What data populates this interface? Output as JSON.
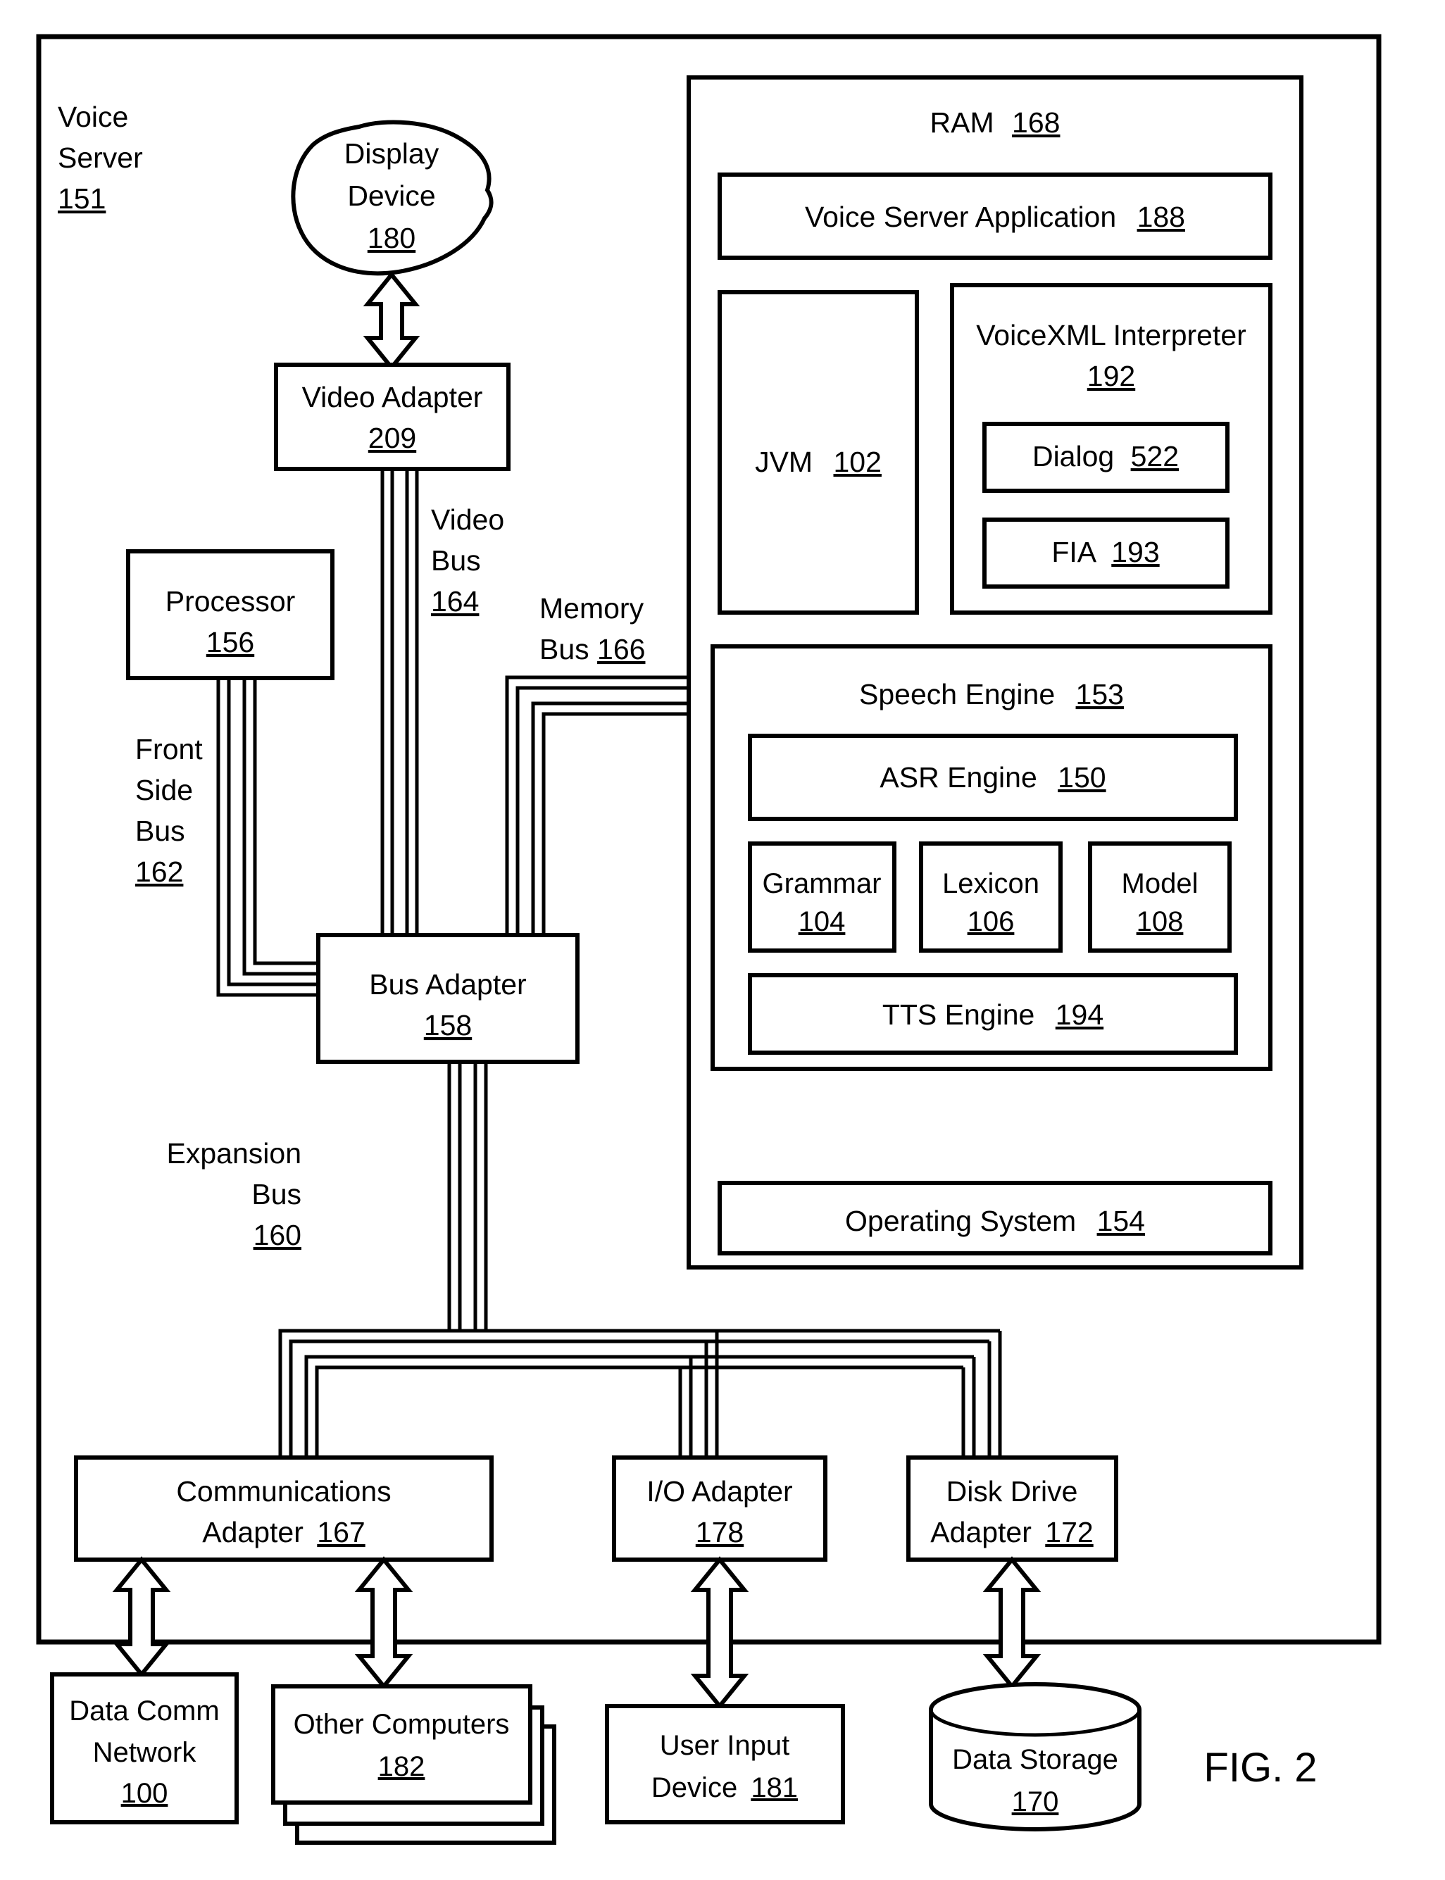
{
  "figure": {
    "caption": "FIG. 2",
    "outer_label": {
      "name": "Voice Server",
      "ref": "151"
    }
  },
  "nodes": {
    "display_device": {
      "name": "Display Device",
      "ref": "180",
      "shape": "blob"
    },
    "video_adapter": {
      "name": "Video Adapter",
      "ref": "209",
      "shape": "rect"
    },
    "processor": {
      "name": "Processor",
      "ref": "156",
      "shape": "rect"
    },
    "bus_adapter": {
      "name": "Bus Adapter",
      "ref": "158",
      "shape": "rect"
    },
    "communications_adapter": {
      "name": "Communications Adapter",
      "ref": "167",
      "shape": "rect"
    },
    "io_adapter": {
      "name": "I/O Adapter",
      "ref": "178",
      "shape": "rect"
    },
    "disk_drive_adapter": {
      "name": "Disk Drive Adapter",
      "ref": "172",
      "shape": "rect"
    },
    "data_comm_network": {
      "name": "Data Comm Network",
      "ref": "100",
      "shape": "rect"
    },
    "other_computers": {
      "name": "Other Computers",
      "ref": "182",
      "shape": "stacked-rect"
    },
    "user_input_device": {
      "name": "User Input Device",
      "ref": "181",
      "shape": "rect"
    },
    "data_storage": {
      "name": "Data Storage",
      "ref": "170",
      "shape": "cylinder"
    }
  },
  "ram": {
    "name": "RAM",
    "ref": "168",
    "children": {
      "voice_server_application": {
        "name": "Voice Server Application",
        "ref": "188"
      },
      "jvm": {
        "name": "JVM",
        "ref": "102"
      },
      "voicexml_interpreter": {
        "name": "VoiceXML Interpreter",
        "ref": "192",
        "children": {
          "dialog": {
            "name": "Dialog",
            "ref": "522"
          },
          "fia": {
            "name": "FIA",
            "ref": "193"
          }
        }
      },
      "speech_engine": {
        "name": "Speech Engine",
        "ref": "153",
        "children": {
          "asr_engine": {
            "name": "ASR Engine",
            "ref": "150"
          },
          "grammar": {
            "name": "Grammar",
            "ref": "104"
          },
          "lexicon": {
            "name": "Lexicon",
            "ref": "106"
          },
          "model": {
            "name": "Model",
            "ref": "108"
          },
          "tts_engine": {
            "name": "TTS Engine",
            "ref": "194"
          }
        }
      },
      "operating_system": {
        "name": "Operating System",
        "ref": "154"
      }
    }
  },
  "buses": {
    "video_bus": {
      "name": "Video Bus",
      "ref": "164"
    },
    "memory_bus": {
      "name": "Memory Bus",
      "ref": "166"
    },
    "front_side_bus": {
      "name": "Front Side Bus",
      "ref": "162"
    },
    "expansion_bus": {
      "name": "Expansion Bus",
      "ref": "160"
    }
  },
  "colors": {
    "ink": "#000000",
    "paper": "#ffffff"
  }
}
